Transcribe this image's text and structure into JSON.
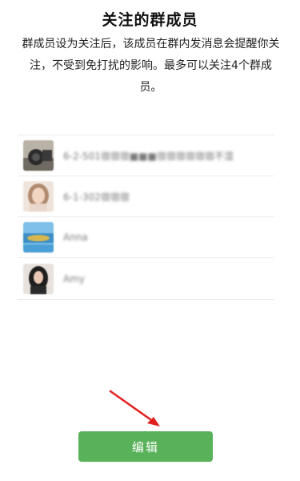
{
  "header": {
    "title": "关注的群成员"
  },
  "description": "群成员设为关注后，该成员在群内发消息会提醒你关注，不受到免打扰的影响。最多可以关注4个群成员。",
  "members": [
    {
      "name": "6-2-501宿宿宿■■■宿宿宿宿宿宿不湿",
      "avatar": "avatar-camera"
    },
    {
      "name": "6-1-302宿宿宿",
      "avatar": "avatar-girl"
    },
    {
      "name": "Anna",
      "avatar": "avatar-landscape"
    },
    {
      "name": "Amy",
      "avatar": "avatar-portrait"
    }
  ],
  "actions": {
    "edit_label": "编辑"
  },
  "colors": {
    "button": "#59b25a",
    "arrow": "#e02020"
  }
}
